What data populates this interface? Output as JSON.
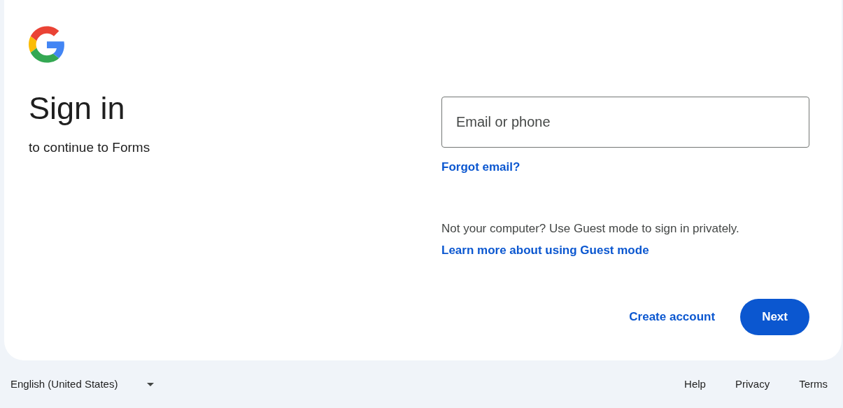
{
  "heading": "Sign in",
  "subheading": "to continue to Forms",
  "email_field": {
    "placeholder": "Email or phone"
  },
  "forgot_link": "Forgot email?",
  "guest_notice": "Not your computer? Use Guest mode to sign in privately.",
  "guest_link": "Learn more about using Guest mode",
  "buttons": [
    {
      "label": "Create account",
      "kind": "text"
    },
    {
      "label": "Next",
      "kind": "filled"
    }
  ],
  "footer": {
    "language": "English (United States)",
    "links": [
      "Help",
      "Privacy",
      "Terms"
    ]
  }
}
